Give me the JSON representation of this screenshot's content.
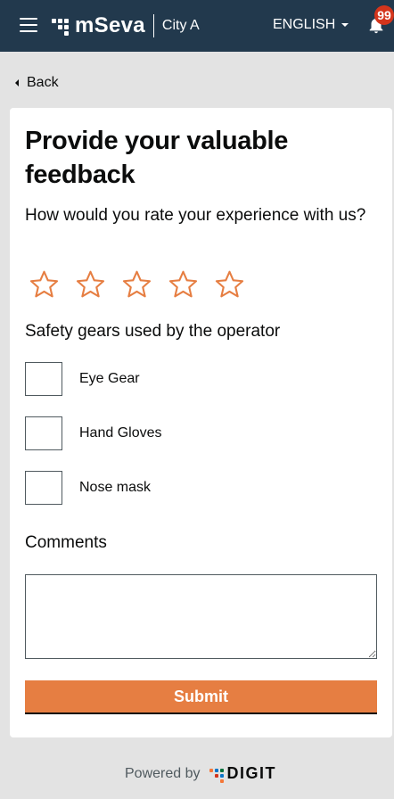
{
  "header": {
    "app_name": "mSeva",
    "city": "City A",
    "language": "ENGLISH",
    "notification_count": "99",
    "background_color": "#22394d",
    "badge_color": "#d4351c"
  },
  "nav": {
    "back_label": "Back"
  },
  "form": {
    "title": "Provide your valuable feedback",
    "rating_question": "How would you rate your experience with us?",
    "rating": {
      "value": 0,
      "max": 5,
      "star_color": "#e67e42"
    },
    "safety_label": "Safety gears used by the operator",
    "safety_options": [
      {
        "label": "Eye Gear",
        "checked": false
      },
      {
        "label": "Hand Gloves",
        "checked": false
      },
      {
        "label": "Nose mask",
        "checked": false
      }
    ],
    "comments_label": "Comments",
    "comments_value": "",
    "submit_label": "Submit",
    "submit_color": "#e67e42"
  },
  "footer": {
    "powered_by": "Powered by",
    "brand": "DIGIT"
  },
  "icons": {
    "menu": "hamburger-icon",
    "bell": "bell-icon",
    "back": "back-arrow-icon",
    "star": "star-outline-icon"
  }
}
